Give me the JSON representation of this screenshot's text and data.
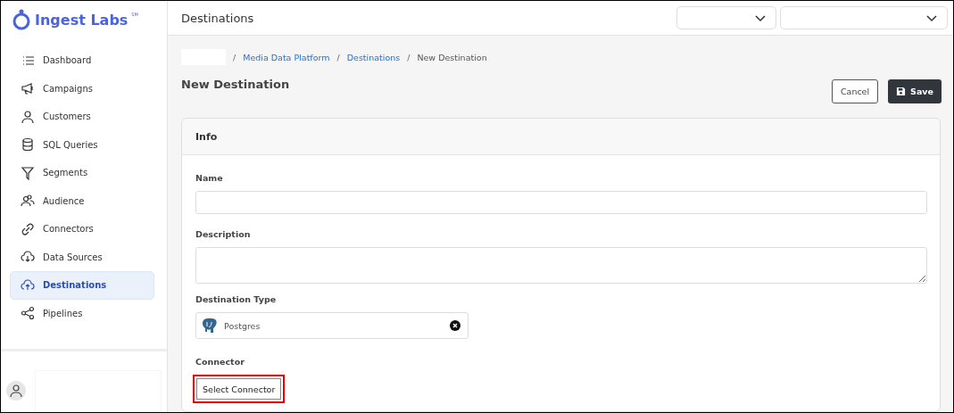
{
  "brand": {
    "name": "Ingest Labs",
    "mark": "SM"
  },
  "sidebar": {
    "items": [
      {
        "label": "Dashboard",
        "selected": false
      },
      {
        "label": "Campaigns",
        "selected": false
      },
      {
        "label": "Customers",
        "selected": false
      },
      {
        "label": "SQL Queries",
        "selected": false
      },
      {
        "label": "Segments",
        "selected": false
      },
      {
        "label": "Audience",
        "selected": false
      },
      {
        "label": "Connectors",
        "selected": false
      },
      {
        "label": "Data Sources",
        "selected": false
      },
      {
        "label": "Destinations",
        "selected": true
      },
      {
        "label": "Pipelines",
        "selected": false
      }
    ]
  },
  "header": {
    "title": "Destinations"
  },
  "breadcrumb": [
    {
      "separator": "/",
      "label": "Media Data Platform"
    },
    {
      "separator": "/",
      "label": "Destinations"
    },
    {
      "separator": "/",
      "label": "New Destination"
    }
  ],
  "page": {
    "title": "New Destination",
    "buttons": {
      "cancel": "Cancel",
      "save": "Save"
    }
  },
  "card": {
    "title": "Info",
    "fields": [
      {
        "kind": "input",
        "label": "Name"
      },
      {
        "kind": "textarea",
        "label": "Description"
      },
      {
        "kind": "select",
        "label": "Destination Type",
        "value": "Postgres"
      },
      {
        "kind": "button",
        "label": "Connector",
        "button": "Select Connector",
        "highlighted": true
      }
    ]
  }
}
